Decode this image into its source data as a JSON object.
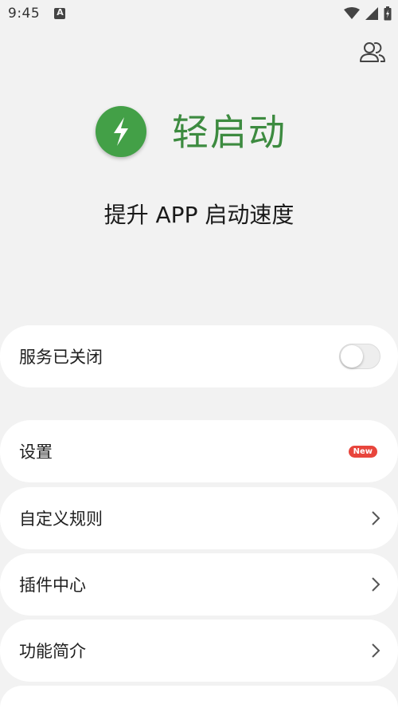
{
  "status_bar": {
    "time": "9:45",
    "icons": [
      "notification-a-icon",
      "wifi-icon",
      "signal-icon",
      "battery-icon"
    ]
  },
  "header": {
    "people_icon": "people-icon"
  },
  "hero": {
    "logo_icon": "lightning-icon",
    "app_title": "轻启动",
    "subtitle": "提升 APP 启动速度"
  },
  "service": {
    "label": "服务已关闭",
    "enabled": false
  },
  "menu": {
    "items": [
      {
        "label": "设置",
        "badge": "New"
      },
      {
        "label": "自定义规则",
        "icon": "chevron-right-icon"
      },
      {
        "label": "插件中心",
        "icon": "chevron-right-icon"
      },
      {
        "label": "功能简介",
        "icon": "chevron-right-icon"
      }
    ]
  },
  "colors": {
    "accent": "#43a047",
    "title": "#3d8b40",
    "background": "#f2f2f2",
    "badge": "#e8453c"
  }
}
